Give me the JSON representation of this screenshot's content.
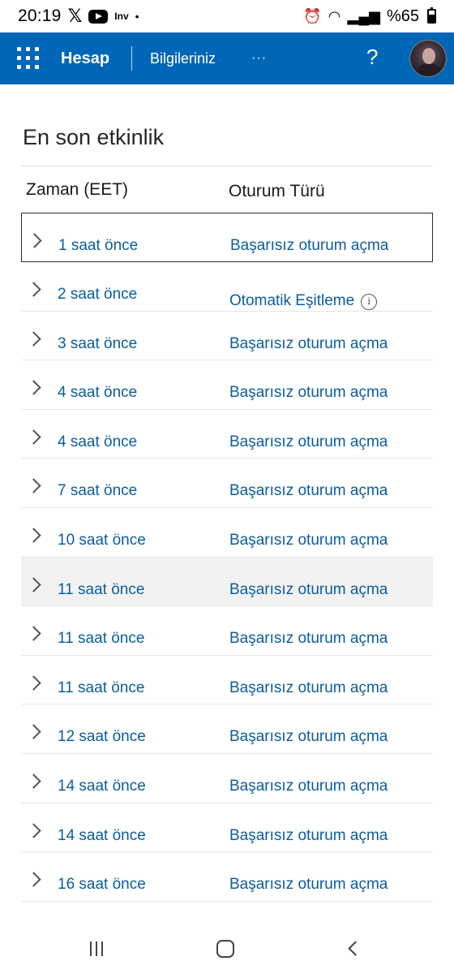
{
  "status_bar": {
    "time": "20:19",
    "app_icons": [
      "x-icon",
      "youtube-icon",
      "investing-icon"
    ],
    "inv_label": "Inv",
    "dot": "•",
    "battery": "%65"
  },
  "app_bar": {
    "brand": "Hesap",
    "section": "Bilgileriniz",
    "more": "···",
    "help": "?",
    "accent_color": "#0067b8"
  },
  "page": {
    "title": "En son etkinlik",
    "columns": {
      "time": "Zaman (EET)",
      "type": "Oturum Türü"
    }
  },
  "rows": [
    {
      "time": "1 saat önce",
      "type": "Başarısız oturum açma"
    },
    {
      "time": "2 saat önce",
      "type": "Otomatik Eşitleme",
      "info": "i"
    },
    {
      "time": "3 saat önce",
      "type": "Başarısız oturum açma"
    },
    {
      "time": "4 saat önce",
      "type": "Başarısız oturum açma"
    },
    {
      "time": "4 saat önce",
      "type": "Başarısız oturum açma"
    },
    {
      "time": "7 saat önce",
      "type": "Başarısız oturum açma"
    },
    {
      "time": "10 saat önce",
      "type": "Başarısız oturum açma"
    },
    {
      "time": "11 saat önce",
      "type": "Başarısız oturum açma"
    },
    {
      "time": "11 saat önce",
      "type": "Başarısız oturum açma"
    },
    {
      "time": "11 saat önce",
      "type": "Başarısız oturum açma"
    },
    {
      "time": "12 saat önce",
      "type": "Başarısız oturum açma"
    },
    {
      "time": "14 saat önce",
      "type": "Başarısız oturum açma"
    },
    {
      "time": "14 saat önce",
      "type": "Başarısız oturum açma"
    },
    {
      "time": "16 saat önce",
      "type": "Başarısız oturum açma"
    }
  ],
  "link_color": "#0b5c9e"
}
